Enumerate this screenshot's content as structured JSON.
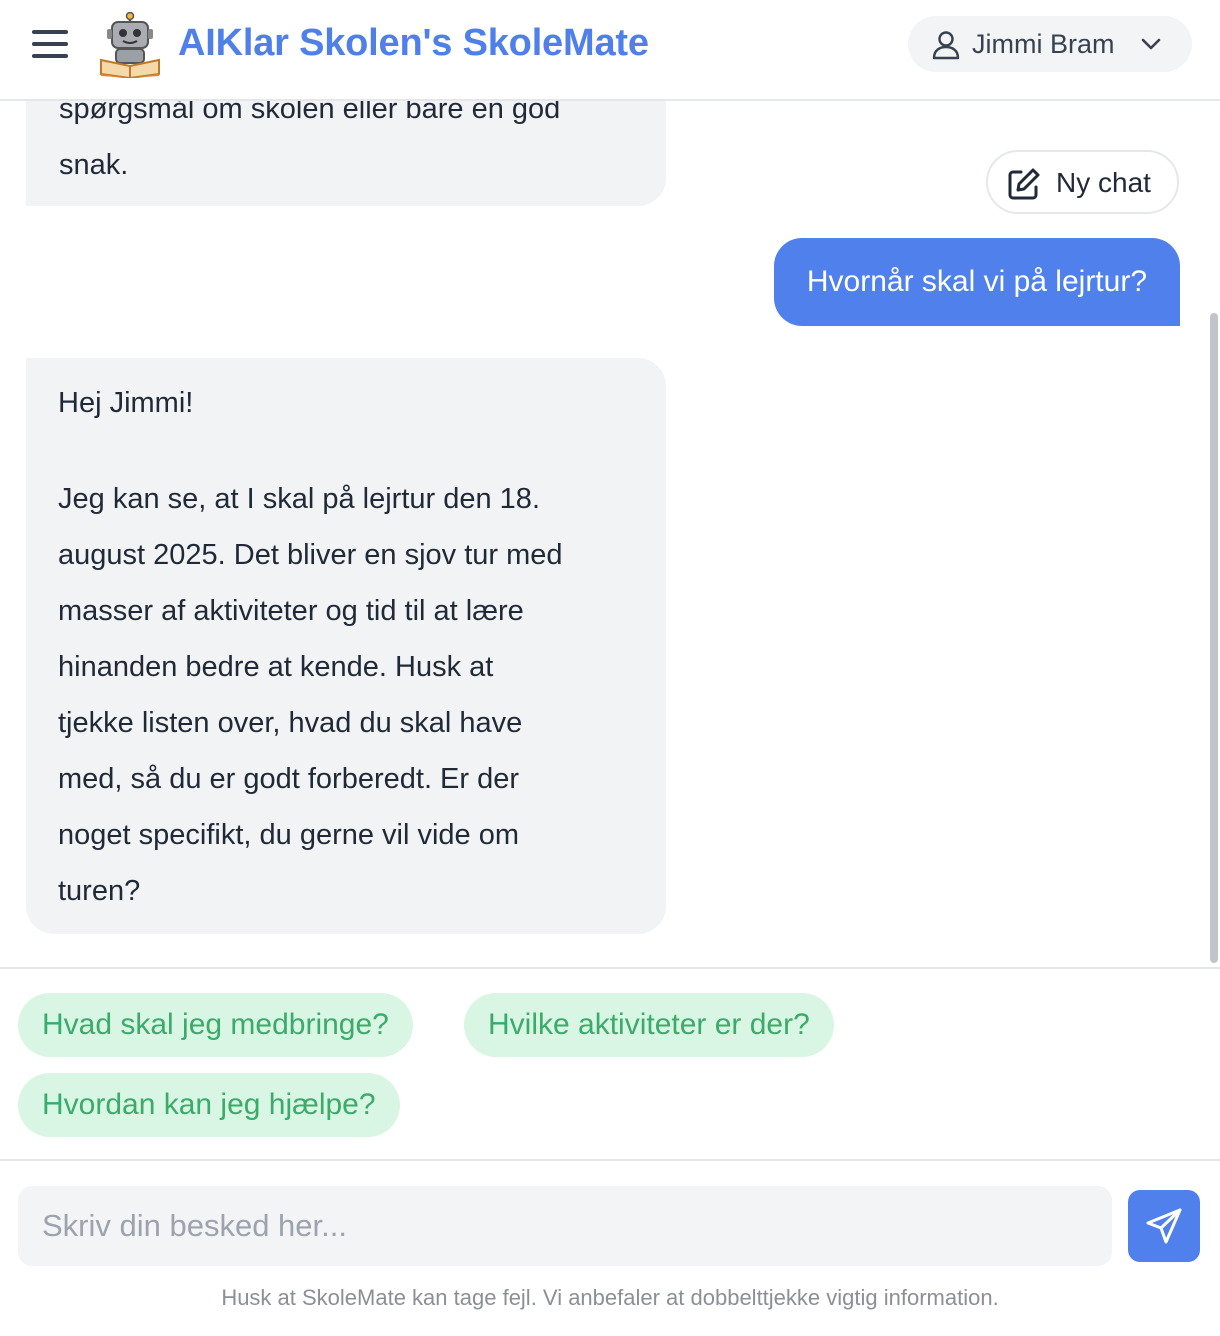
{
  "header": {
    "title": "AIKlar Skolen's SkoleMate",
    "user_name": "Jimmi Bram",
    "menu_icon": "hamburger-menu-icon",
    "logo_icon": "robot-reading-book-icon",
    "user_icon": "user-icon",
    "dropdown_icon": "chevron-down-icon"
  },
  "chat": {
    "new_chat_label": "Ny chat",
    "new_chat_icon": "edit-icon",
    "messages": [
      {
        "role": "assistant",
        "lines": [
          "spørgsmål om skolen eller bare en god",
          "snak."
        ]
      },
      {
        "role": "user",
        "text": "Hvornår skal vi på lejrtur?"
      },
      {
        "role": "assistant",
        "lines": [
          "Hej Jimmi!",
          "",
          "Jeg kan se, at I skal på lejrtur den 18.",
          "august 2025. Det bliver en sjov tur med",
          "masser af aktiviteter og tid til at lære",
          "hinanden bedre at kende. Husk at",
          "tjekke listen over, hvad du skal have",
          "med, så du er godt forberedt. Er der",
          "noget specifikt, du gerne vil vide om",
          "turen?"
        ]
      }
    ]
  },
  "suggestions": [
    "Hvad skal jeg medbringe?",
    "Hvilke aktiviteter er der?",
    "Hvordan kan jeg hjælpe?"
  ],
  "composer": {
    "placeholder": "Skriv din besked her...",
    "value": "",
    "send_icon": "send-icon"
  },
  "disclaimer": "Husk at SkoleMate kan tage fejl. Vi anbefaler at dobbelttjekke vigtig information.",
  "colors": {
    "accent": "#4f80ec",
    "title": "#4f7fe8",
    "chip_bg": "#d9f6e4",
    "chip_text": "#3aab6a",
    "bot_bubble": "#f2f3f5"
  }
}
